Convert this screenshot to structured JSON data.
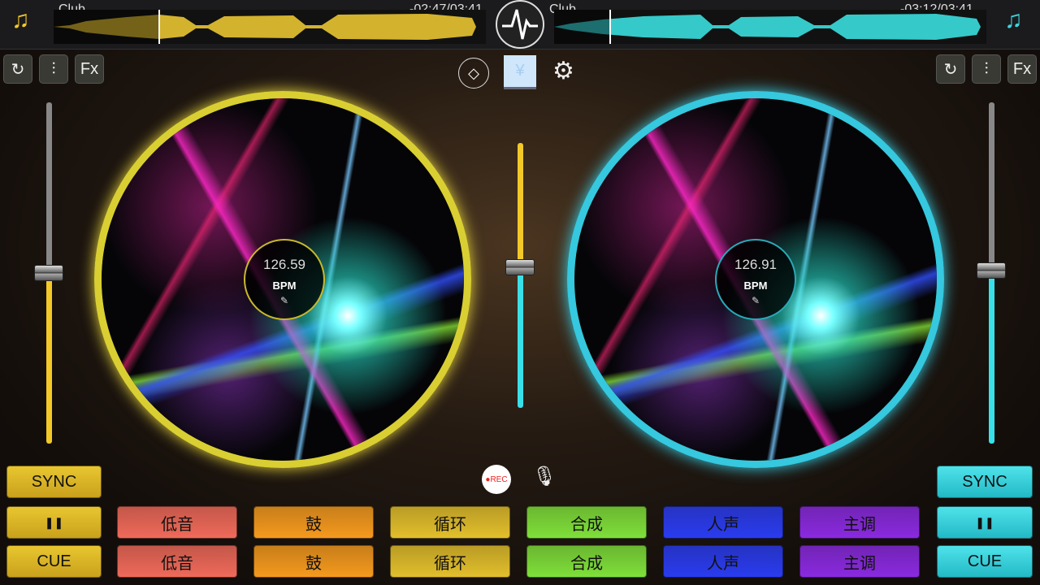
{
  "deck_a": {
    "track": "Club",
    "time": "-02:47/03:41",
    "bpm": "126.59",
    "bpm_label": "BPM",
    "color": "#d9c12e",
    "progress": 0.245
  },
  "deck_b": {
    "track": "Club",
    "time": "-03:12/03:41",
    "bpm": "126.91",
    "bpm_label": "BPM",
    "color": "#2ed3df",
    "progress": 0.131
  },
  "toolbar": {
    "fx_label": "Fx"
  },
  "controls": {
    "sync": "SYNC",
    "pause": "❚❚",
    "cue": "CUE",
    "rec": "●REC"
  },
  "pads": [
    "低音",
    "鼓",
    "循环",
    "合成",
    "人声",
    "主调"
  ],
  "pad_colors": [
    "#f06a5a",
    "#f59a1e",
    "#e2bf2c",
    "#7fe03a",
    "#2a3cf0",
    "#8a2ae0"
  ]
}
